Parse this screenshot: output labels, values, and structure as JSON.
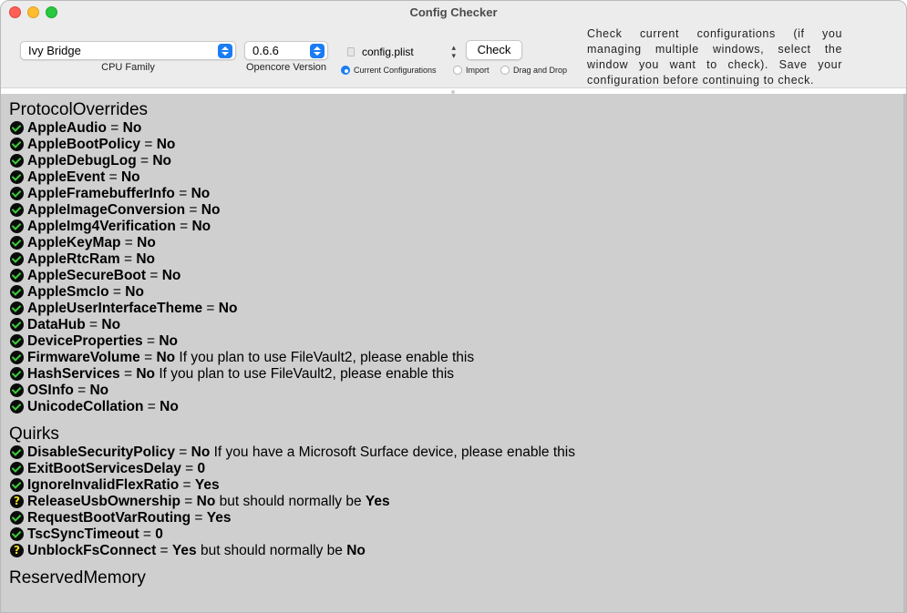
{
  "window": {
    "title": "Config Checker"
  },
  "toolbar": {
    "cpu_family": {
      "value": "Ivy Bridge",
      "caption": "CPU Family"
    },
    "opencore_version": {
      "value": "0.6.6",
      "caption": "Opencore Version"
    },
    "file": {
      "name": "config.plist",
      "icon": "document-icon"
    },
    "check_label": "Check",
    "radios": [
      {
        "label": "Current Configurations",
        "selected": true
      },
      {
        "label": "Import",
        "selected": false
      },
      {
        "label": "Drag and Drop",
        "selected": false
      }
    ],
    "instructions": "Check current configurations (if you managing multiple windows, select the window you want to check). Save your configuration before continuing to check."
  },
  "colors": {
    "ok": "#3fcc39",
    "warn": "#f2e11e",
    "accent": "#1a7cf5",
    "content_bg": "#cfcfcf"
  },
  "sections": [
    {
      "title": "ProtocolOverrides",
      "entries": [
        {
          "status": "ok",
          "key": "AppleAudio",
          "eq": " = ",
          "value": "No"
        },
        {
          "status": "ok",
          "key": "AppleBootPolicy",
          "eq": " = ",
          "value": "No"
        },
        {
          "status": "ok",
          "key": "AppleDebugLog",
          "eq": " = ",
          "value": "No"
        },
        {
          "status": "ok",
          "key": "AppleEvent",
          "eq": " = ",
          "value": "No"
        },
        {
          "status": "ok",
          "key": "AppleFramebufferInfo",
          "eq": " = ",
          "value": "No"
        },
        {
          "status": "ok",
          "key": "AppleImageConversion",
          "eq": " = ",
          "value": "No"
        },
        {
          "status": "ok",
          "key": "AppleImg4Verification",
          "eq": " = ",
          "value": "No"
        },
        {
          "status": "ok",
          "key": "AppleKeyMap",
          "eq": " = ",
          "value": "No"
        },
        {
          "status": "ok",
          "key": "AppleRtcRam",
          "eq": " = ",
          "value": "No"
        },
        {
          "status": "ok",
          "key": "AppleSecureBoot",
          "eq": " = ",
          "value": "No"
        },
        {
          "status": "ok",
          "key": "AppleSmcIo",
          "eq": " = ",
          "value": "No"
        },
        {
          "status": "ok",
          "key": "AppleUserInterfaceTheme",
          "eq": " = ",
          "value": "No"
        },
        {
          "status": "ok",
          "key": "DataHub",
          "eq": " = ",
          "value": "No"
        },
        {
          "status": "ok",
          "key": "DeviceProperties",
          "eq": " = ",
          "value": "No"
        },
        {
          "status": "ok",
          "key": "FirmwareVolume",
          "eq": " = ",
          "value": "No",
          "note": " If you plan to use FileVault2, please enable this"
        },
        {
          "status": "ok",
          "key": "HashServices",
          "eq": " = ",
          "value": "No",
          "note": " If you plan to use FileVault2, please enable this"
        },
        {
          "status": "ok",
          "key": "OSInfo",
          "eq": " = ",
          "value": "No"
        },
        {
          "status": "ok",
          "key": "UnicodeCollation",
          "eq": " = ",
          "value": "No"
        }
      ]
    },
    {
      "title": "Quirks",
      "entries": [
        {
          "status": "ok",
          "key": "DisableSecurityPolicy",
          "eq": " = ",
          "value": "No",
          "note": " If you have a Microsoft Surface device, please enable this"
        },
        {
          "status": "ok",
          "key": "ExitBootServicesDelay",
          "eq": " = ",
          "value": "0"
        },
        {
          "status": "ok",
          "key": "IgnoreInvalidFlexRatio",
          "eq": " = ",
          "value": "Yes"
        },
        {
          "status": "warn",
          "key": "ReleaseUsbOwnership",
          "eq": " = ",
          "value": "No",
          "note": " but should normally be ",
          "expected": "Yes"
        },
        {
          "status": "ok",
          "key": "RequestBootVarRouting",
          "eq": " = ",
          "value": "Yes"
        },
        {
          "status": "ok",
          "key": "TscSyncTimeout",
          "eq": " = ",
          "value": "0"
        },
        {
          "status": "warn",
          "key": "UnblockFsConnect",
          "eq": " = ",
          "value": "Yes",
          "note": " but should normally be ",
          "expected": "No"
        }
      ]
    },
    {
      "title": "ReservedMemory",
      "entries": []
    }
  ]
}
